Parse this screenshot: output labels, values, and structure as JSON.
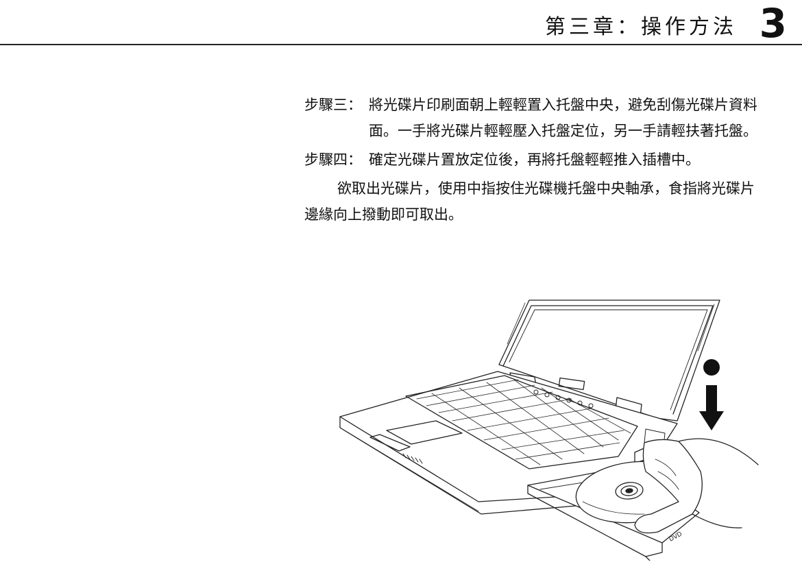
{
  "header": {
    "chapter_title": "第三章：操作方法",
    "chapter_number": "3"
  },
  "steps": [
    {
      "label": "步驟三：",
      "text": "將光碟片印刷面朝上輕輕置入托盤中央，避免刮傷光碟片資料面。一手將光碟片輕輕壓入托盤定位，另一手請輕扶著托盤。"
    },
    {
      "label": "步驟四：",
      "text": "確定光碟片置放定位後，再將托盤輕輕推入插槽中。"
    }
  ],
  "paragraph": "欲取出光碟片，使用中指按住光碟機托盤中央軸承，食指將光碟片邊緣向上撥動即可取出。",
  "illustration": {
    "drive_label": "DVD"
  }
}
